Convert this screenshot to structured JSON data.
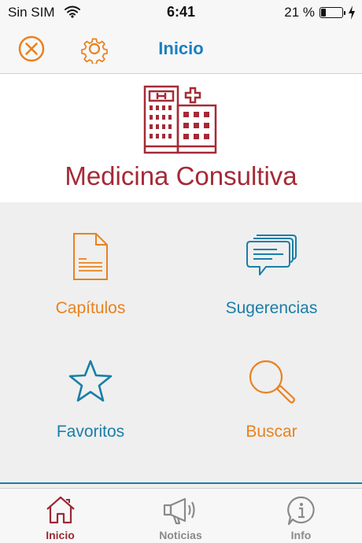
{
  "status": {
    "carrier": "Sin SIM",
    "time": "6:41",
    "battery": "21 %"
  },
  "nav": {
    "title": "Inicio"
  },
  "banner": {
    "title": "Medicina Consultiva"
  },
  "menu": {
    "capitulos": "Capítulos",
    "sugerencias": "Sugerencias",
    "favoritos": "Favoritos",
    "buscar": "Buscar"
  },
  "tabs": {
    "inicio": "Inicio",
    "noticias": "Noticias",
    "info": "Info"
  },
  "colors": {
    "accent_orange": "#e8821e",
    "accent_teal": "#1a7ea8",
    "brand_red": "#a52a36",
    "nav_blue": "#1a7fc4"
  }
}
